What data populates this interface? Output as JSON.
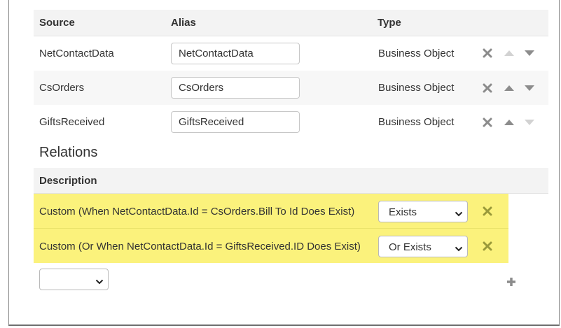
{
  "sources_table": {
    "headers": {
      "source": "Source",
      "alias": "Alias",
      "type": "Type"
    },
    "rows": [
      {
        "source": "NetContactData",
        "alias": "NetContactData",
        "type": "Business Object"
      },
      {
        "source": "CsOrders",
        "alias": "CsOrders",
        "type": "Business Object"
      },
      {
        "source": "GiftsReceived",
        "alias": "GiftsReceived",
        "type": "Business Object"
      }
    ]
  },
  "relations": {
    "title": "Relations",
    "header": "Description",
    "rows": [
      {
        "description": "Custom (When NetContactData.Id = CsOrders.Bill To Id Does Exist)",
        "operator": "Exists"
      },
      {
        "description": "Custom (Or When NetContactData.Id = GiftsReceived.ID Does Exist)",
        "operator": "Or Exists"
      }
    ],
    "new_relation_select": ""
  },
  "colors": {
    "highlight": "#fbf27c",
    "icon_gray": "#8a8a8a",
    "icon_olive": "#9a9a3a"
  }
}
